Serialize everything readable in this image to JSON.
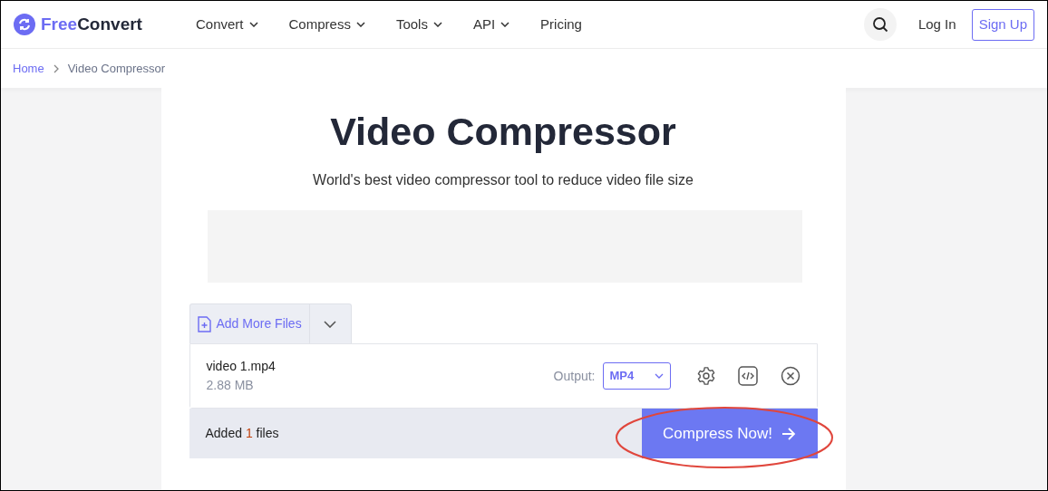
{
  "header": {
    "logo": {
      "brand_first": "Free",
      "brand_second": "Convert"
    },
    "nav": [
      {
        "label": "Convert",
        "dropdown": true
      },
      {
        "label": "Compress",
        "dropdown": true
      },
      {
        "label": "Tools",
        "dropdown": true
      },
      {
        "label": "API",
        "dropdown": true
      },
      {
        "label": "Pricing",
        "dropdown": false
      }
    ],
    "login": "Log In",
    "signup": "Sign Up"
  },
  "breadcrumb": [
    {
      "label": "Home",
      "link": true
    },
    {
      "label": "Video Compressor",
      "link": false
    }
  ],
  "title": "Video Compressor",
  "subtitle": "World's best video compressor tool to reduce video file size",
  "uploader": {
    "add_more": "Add More Files",
    "files": [
      {
        "name": "video 1.mp4",
        "size": "2.88 MB",
        "output_label": "Output:",
        "format": "MP4"
      }
    ],
    "added_prefix": "Added",
    "added_count": "1",
    "added_suffix": "files",
    "compress_button": {
      "label": "Compress Now!",
      "highlighted": true
    }
  }
}
